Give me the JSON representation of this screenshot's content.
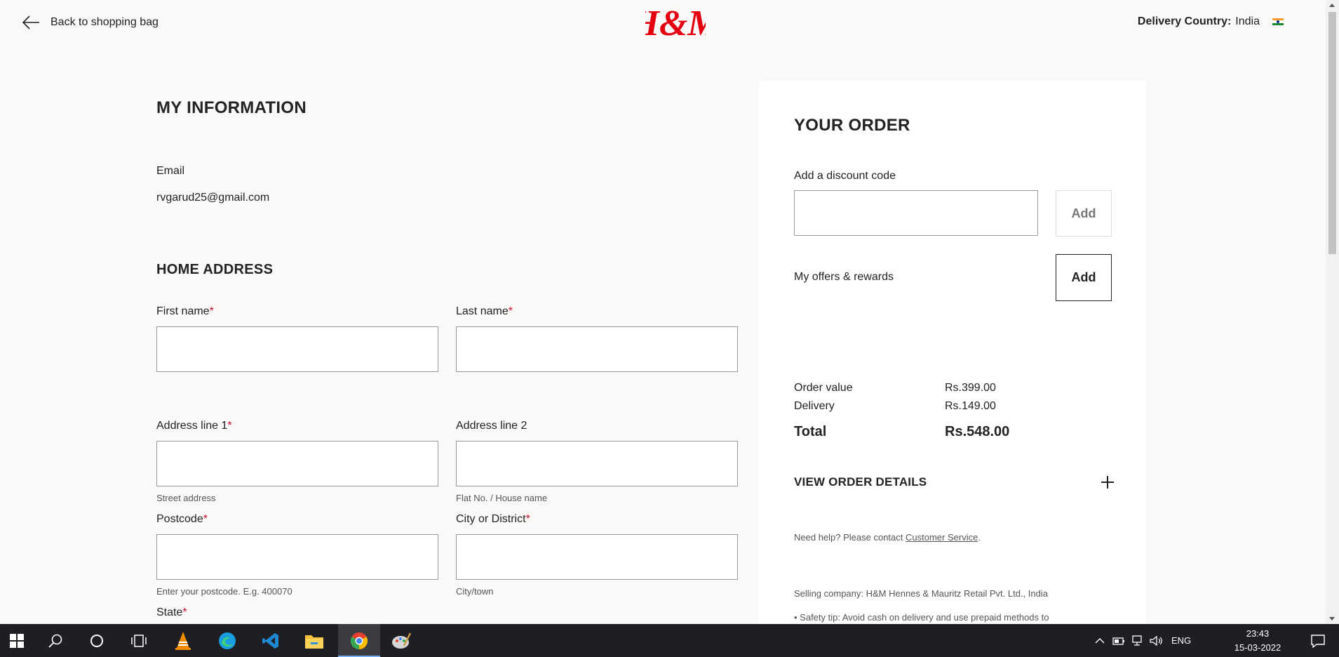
{
  "header": {
    "back_label": "Back to shopping bag",
    "logo_text": "H&M",
    "country_label": "Delivery Country:",
    "country_value": "India"
  },
  "info": {
    "title": "MY INFORMATION",
    "email_label": "Email",
    "email_value": "rvgarud25@gmail.com"
  },
  "address": {
    "title": "HOME ADDRESS",
    "first_name": "First name",
    "last_name": "Last name",
    "address1": "Address line 1",
    "address1_hint": "Street address",
    "address2": "Address line 2",
    "address2_hint": "Flat No. / House name",
    "postcode": "Postcode",
    "postcode_hint": "Enter your postcode. E.g. 400070",
    "city": "City or District",
    "city_hint": "City/town",
    "state": "State",
    "required_mark": "*"
  },
  "order": {
    "title": "YOUR ORDER",
    "discount_label": "Add a discount code",
    "add_label": "Add",
    "offers_label": "My offers & rewards",
    "order_value_label": "Order value",
    "order_value": "Rs.399.00",
    "delivery_label": "Delivery",
    "delivery_value": "Rs.149.00",
    "total_label": "Total",
    "total_value": "Rs.548.00",
    "view_details": "VIEW ORDER DETAILS",
    "help_prefix": "Need help? Please contact ",
    "help_link": "Customer Service",
    "help_suffix": ".",
    "selling_company": "Selling company: H&M Hennes & Mauritz Retail Pvt. Ltd., India",
    "safety_tip": "• Safety tip: Avoid cash on delivery and use prepaid methods to"
  },
  "taskbar": {
    "language": "ENG",
    "time": "23:43",
    "date": "15-03-2022"
  },
  "colors": {
    "brand_red": "#e50010",
    "required_red": "#c8102e",
    "taskbar_bg": "#1e1f24"
  }
}
